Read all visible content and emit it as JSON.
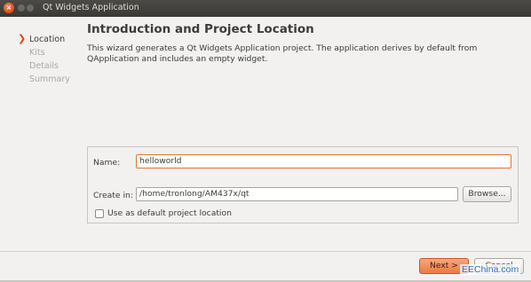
{
  "window": {
    "title": "Qt Widgets Application",
    "close_glyph": "×"
  },
  "steps": [
    {
      "label": "Location",
      "active": true
    },
    {
      "label": "Kits",
      "active": false
    },
    {
      "label": "Details",
      "active": false
    },
    {
      "label": "Summary",
      "active": false
    }
  ],
  "step_arrow": "❯",
  "page": {
    "heading": "Introduction and Project Location",
    "description": "This wizard generates a Qt Widgets Application project. The application derives by default from QApplication and includes an empty widget."
  },
  "form": {
    "name_label": "Name:",
    "name_value": "helloworld",
    "create_in_label": "Create in:",
    "create_in_value": "/home/tronlong/AM437x/qt",
    "browse_label": "Browse...",
    "default_location_label": "Use as default project location",
    "default_location_checked": false
  },
  "buttons": {
    "next_label": "Next >",
    "cancel_label": "Cancel"
  },
  "watermark": "EEChina.com",
  "colors": {
    "accent": "#dd4814",
    "default_button": "#ec7a44",
    "focus_border": "#e8742f"
  }
}
